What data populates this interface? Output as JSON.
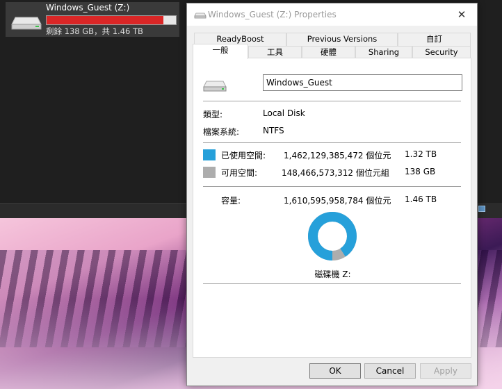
{
  "explorer": {
    "drive_name": "Windows_Guest (Z:)",
    "drive_space_text": "剩餘 138 GB，共 1.46 TB",
    "drive_used_fraction": 0.905
  },
  "dialog": {
    "title": "Windows_Guest (Z:) Properties",
    "close_glyph": "✕",
    "tabs_row1": [
      "ReadyBoost",
      "Previous Versions",
      "自訂"
    ],
    "tabs_row2": [
      "一般",
      "工具",
      "硬體",
      "Sharing",
      "Security"
    ],
    "active_tab": "一般",
    "volume_label_value": "Windows_Guest",
    "type_label": "類型:",
    "type_value": "Local Disk",
    "fs_label": "檔案系統:",
    "fs_value": "NTFS",
    "used_label": "已使用空間:",
    "used_bytes": "1,462,129,385,472 個位元",
    "used_size": "1.32 TB",
    "free_label": "可用空間:",
    "free_bytes": "148,466,573,312 個位元組",
    "free_size": "138 GB",
    "capacity_label": "容量:",
    "capacity_bytes": "1,610,595,958,784 個位元",
    "capacity_size": "1.46 TB",
    "drive_caption": "磁碟機 Z:",
    "used_fraction": 0.908,
    "used_color": "#26a0da",
    "free_color": "#adadad",
    "buttons": {
      "ok": "OK",
      "cancel": "Cancel",
      "apply": "Apply"
    }
  }
}
